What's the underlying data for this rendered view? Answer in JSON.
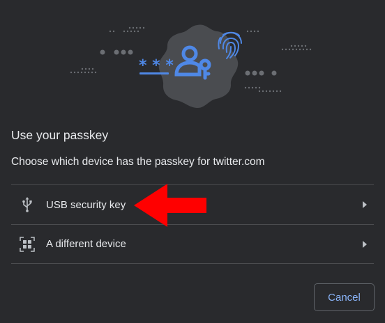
{
  "dialog": {
    "title": "Use your passkey",
    "subtitle": "Choose which device has the passkey for twitter.com"
  },
  "illustration": {
    "password_mask": "***",
    "icons": [
      "passkey-person-key-icon",
      "fingerprint-icon"
    ],
    "accent_color": "#4f88e6"
  },
  "options": [
    {
      "label": "USB security key",
      "icon": "usb-icon"
    },
    {
      "label": "A different device",
      "icon": "qr-code-icon"
    }
  ],
  "annotation": {
    "color": "#ff0000",
    "icon": "red-arrow-icon"
  },
  "actions": {
    "cancel_label": "Cancel"
  }
}
